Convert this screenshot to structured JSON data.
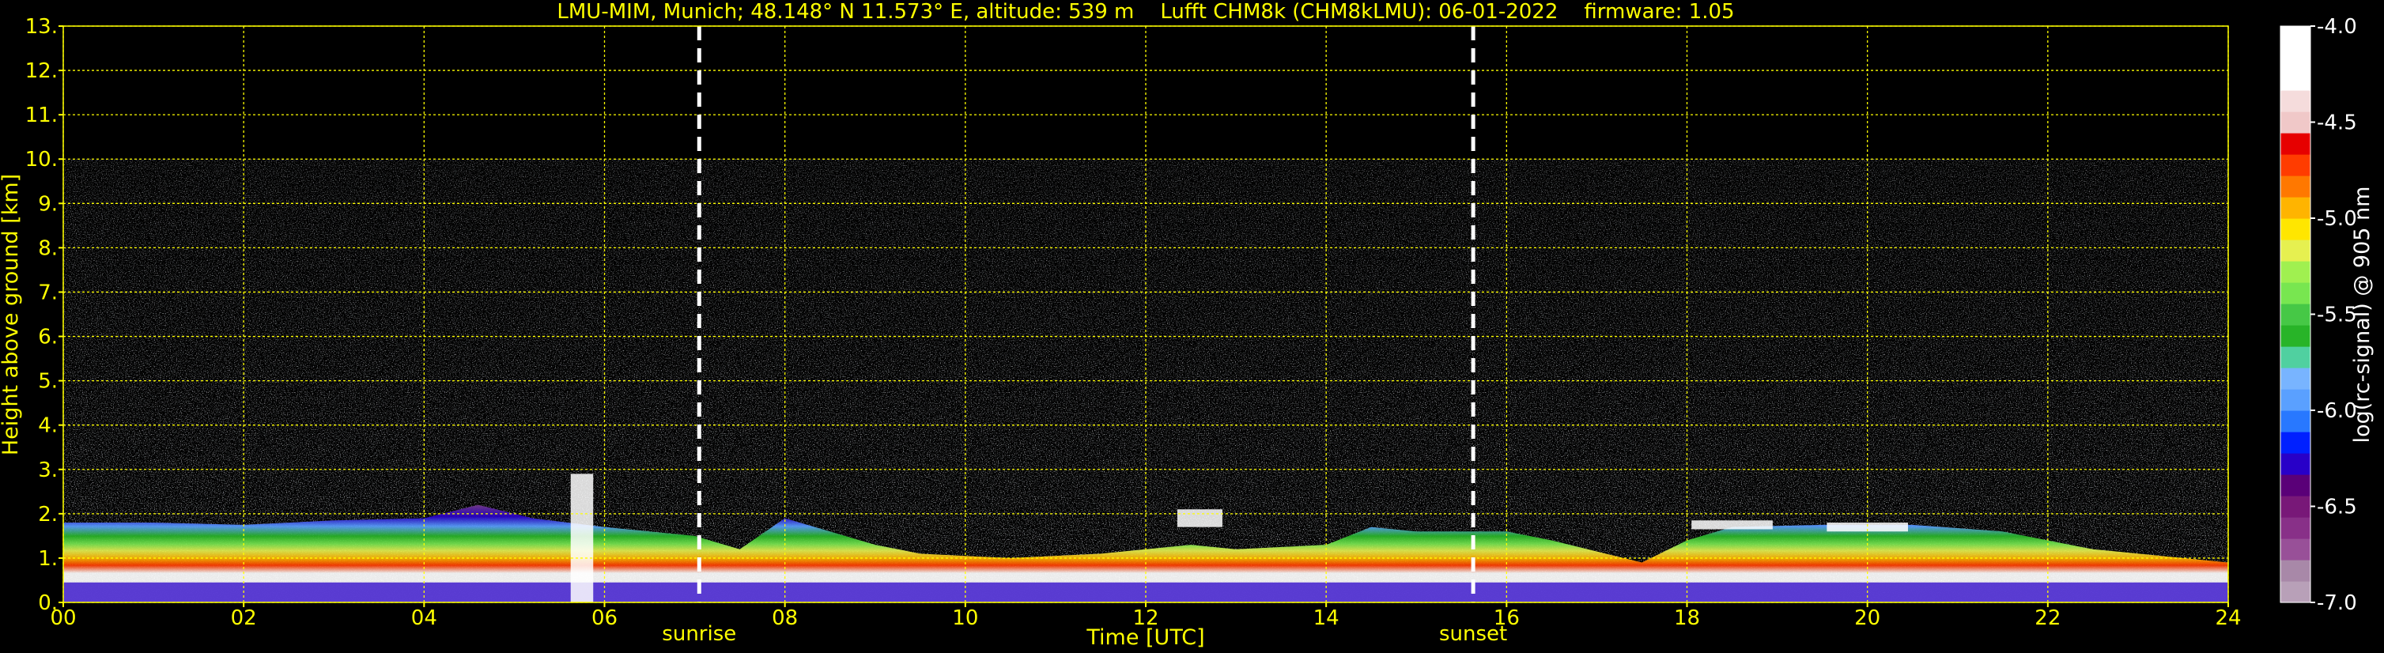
{
  "chart_data": {
    "type": "heatmap",
    "title": "LMU-MIM, Munich; 48.148° N 11.573° E, altitude: 539 m    Lufft CHM8k (CHM8kLMU): 06-01-2022    firmware: 1.05",
    "xlabel": "Time [UTC]",
    "ylabel": "Height above ground [km]",
    "xlim": [
      0,
      24
    ],
    "ylim": [
      0,
      13
    ],
    "x_tick_labels": [
      "00",
      "02",
      "04",
      "06",
      "08",
      "10",
      "12",
      "14",
      "16",
      "18",
      "20",
      "22",
      "24"
    ],
    "y_tick_labels": [
      "0.",
      "1.",
      "2.",
      "3.",
      "4.",
      "5.",
      "6.",
      "7.",
      "8.",
      "9.",
      "10.",
      "11.",
      "12.",
      "13."
    ],
    "grid": true,
    "markers": [
      {
        "label": "sunrise",
        "time": 7.05
      },
      {
        "label": "sunset",
        "time": 15.63
      }
    ],
    "max_signal_height_km": 10,
    "colorbar": {
      "label": "log(rc-signal) @ 905 nm",
      "range": [
        -7.0,
        -4.0
      ],
      "tick_labels": [
        "-4.0",
        "-4.5",
        "-5.0",
        "-5.5",
        "-6.0",
        "-6.5",
        "-7.0"
      ],
      "ticks": [
        -4.0,
        -4.5,
        -5.0,
        -5.5,
        -6.0,
        -6.5,
        -7.0
      ],
      "colors": [
        "#b8a0b8",
        "#a888a8",
        "#985098",
        "#883088",
        "#781878",
        "#5a0078",
        "#2800c8",
        "#0020ff",
        "#2878ff",
        "#5aa0ff",
        "#78b4ff",
        "#50d0a0",
        "#28b428",
        "#46c846",
        "#78e650",
        "#a0f050",
        "#e6f050",
        "#ffe600",
        "#ffb400",
        "#ff7800",
        "#ff3c00",
        "#e60000",
        "#f0c8c8",
        "#f5dcdc",
        "#ffffff",
        "#ffffff",
        "#ffffff"
      ]
    },
    "layers": [
      {
        "name": "boundary_layer",
        "points": [
          [
            0,
            1.8
          ],
          [
            1,
            1.8
          ],
          [
            2,
            1.75
          ],
          [
            3,
            1.85
          ],
          [
            4,
            1.9
          ],
          [
            4.6,
            2.2
          ],
          [
            5.2,
            1.9
          ],
          [
            6,
            1.7
          ],
          [
            7,
            1.5
          ],
          [
            7.5,
            1.2
          ],
          [
            8,
            1.9
          ],
          [
            8.5,
            1.6
          ],
          [
            9,
            1.3
          ],
          [
            9.5,
            1.1
          ],
          [
            10.5,
            1.0
          ],
          [
            11.5,
            1.1
          ],
          [
            12.5,
            1.3
          ],
          [
            13,
            1.2
          ],
          [
            14,
            1.3
          ],
          [
            14.5,
            1.7
          ],
          [
            15,
            1.6
          ],
          [
            15.5,
            1.6
          ],
          [
            16,
            1.6
          ],
          [
            16.5,
            1.4
          ],
          [
            17.5,
            0.9
          ],
          [
            18,
            1.4
          ],
          [
            18.5,
            1.7
          ],
          [
            19.5,
            1.75
          ],
          [
            20.5,
            1.75
          ],
          [
            21.5,
            1.6
          ],
          [
            22.5,
            1.2
          ],
          [
            24,
            0.9
          ]
        ]
      }
    ],
    "cloud_features": [
      {
        "time": 5.75,
        "top": 2.9,
        "bottom": 0.0
      },
      {
        "time": 12.6,
        "top": 2.1,
        "bottom": 1.7
      },
      {
        "time": 18.5,
        "top": 1.85,
        "bottom": 1.65
      },
      {
        "time": 20.0,
        "top": 1.8,
        "bottom": 1.6
      }
    ]
  }
}
